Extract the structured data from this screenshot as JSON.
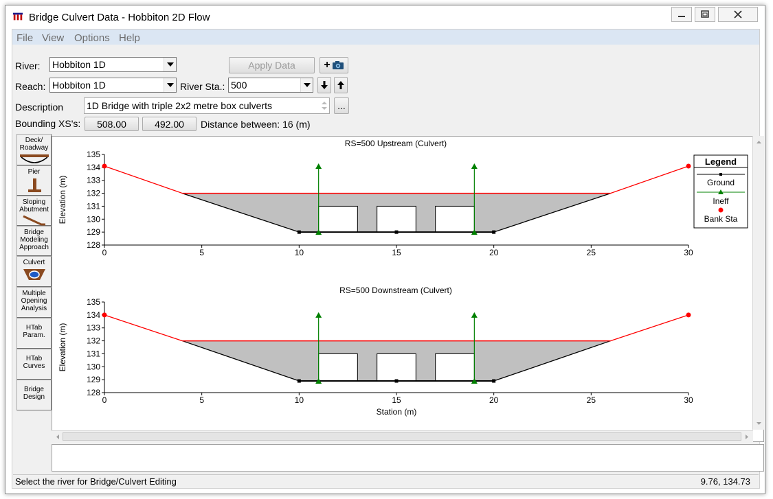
{
  "window": {
    "title": "Bridge Culvert Data - Hobbiton 2D Flow"
  },
  "menu": [
    "File",
    "View",
    "Options",
    "Help"
  ],
  "form": {
    "river_label": "River:",
    "river_value": "Hobbiton 1D",
    "reach_label": "Reach:",
    "reach_value": "Hobbiton 1D",
    "river_sta_label": "River Sta.:",
    "river_sta_value": "500",
    "apply_label": "Apply Data",
    "plus_label": "+",
    "description_label": "Description",
    "description_value": "1D Bridge with triple 2x2 metre box culverts",
    "ellipsis_label": "...",
    "bounding_label": "Bounding XS's:",
    "bounding_up": "508.00",
    "bounding_down": "492.00",
    "distance_text": "Distance between: 16 (m)"
  },
  "sidebar": [
    {
      "label": "Deck/ Roadway",
      "icon": "deck-roadway-icon"
    },
    {
      "label": "Pier",
      "icon": "pier-icon"
    },
    {
      "label": "Sloping Abutment",
      "icon": "sloping-abutment-icon"
    },
    {
      "label": "Bridge Modeling Approach",
      "icon": ""
    },
    {
      "label": "Culvert",
      "icon": "culvert-icon"
    },
    {
      "label": "Multiple Opening Analysis",
      "icon": ""
    },
    {
      "label": "HTab Param.",
      "icon": ""
    },
    {
      "label": "HTab Curves",
      "icon": ""
    },
    {
      "label": "Bridge Design",
      "icon": ""
    }
  ],
  "legend": {
    "title": "Legend",
    "items": [
      "Ground",
      "Ineff",
      "Bank Sta"
    ]
  },
  "colors": {
    "ground": "#000000",
    "ineff": "#008000",
    "bank": "#ff0000",
    "fill": "#c0c0c0",
    "deck": "#ff0000"
  },
  "chart_data": [
    {
      "type": "line",
      "title": "RS=500     Upstream  (Culvert)",
      "xlabel": "",
      "ylabel": "Elevation (m)",
      "xlim": [
        0,
        30
      ],
      "ylim": [
        128,
        135
      ],
      "xticks": [
        0,
        5,
        10,
        15,
        20,
        25,
        30
      ],
      "yticks": [
        128,
        129,
        130,
        131,
        132,
        133,
        134,
        135
      ],
      "ground": [
        [
          0,
          134.1
        ],
        [
          4,
          132
        ],
        [
          10,
          129
        ],
        [
          20,
          129
        ],
        [
          26,
          132
        ],
        [
          30,
          134.1
        ]
      ],
      "ground_markers": [
        [
          10,
          129
        ],
        [
          15,
          129
        ],
        [
          20,
          129
        ]
      ],
      "deck": [
        [
          4,
          132
        ],
        [
          26,
          132
        ]
      ],
      "ineff": [
        {
          "x": 11,
          "y0": 129,
          "y1": 134.1
        },
        {
          "x": 19,
          "y0": 129,
          "y1": 134.1
        }
      ],
      "bank": [
        [
          0,
          134.1
        ],
        [
          30,
          134.1
        ]
      ],
      "culverts": [
        [
          11,
          129,
          13,
          131
        ],
        [
          14,
          129,
          16,
          131
        ],
        [
          17,
          129,
          19,
          131
        ]
      ]
    },
    {
      "type": "line",
      "title": "RS=500     Downstream  (Culvert)",
      "xlabel": "Station (m)",
      "ylabel": "Elevation (m)",
      "xlim": [
        0,
        30
      ],
      "ylim": [
        128,
        135
      ],
      "xticks": [
        0,
        5,
        10,
        15,
        20,
        25,
        30
      ],
      "yticks": [
        128,
        129,
        130,
        131,
        132,
        133,
        134,
        135
      ],
      "ground": [
        [
          0,
          134
        ],
        [
          4,
          132
        ],
        [
          10,
          128.9
        ],
        [
          20,
          128.9
        ],
        [
          26,
          132
        ],
        [
          30,
          134
        ]
      ],
      "ground_markers": [
        [
          10,
          128.9
        ],
        [
          15,
          128.9
        ],
        [
          20,
          128.9
        ]
      ],
      "deck": [
        [
          4,
          132
        ],
        [
          26,
          132
        ]
      ],
      "ineff": [
        {
          "x": 11,
          "y0": 128.9,
          "y1": 134
        },
        {
          "x": 19,
          "y0": 128.9,
          "y1": 134
        }
      ],
      "bank": [
        [
          0,
          134
        ],
        [
          30,
          134
        ]
      ],
      "culverts": [
        [
          11,
          128.9,
          13,
          131
        ],
        [
          14,
          128.9,
          16,
          131
        ],
        [
          17,
          128.9,
          19,
          131
        ]
      ]
    }
  ],
  "status": {
    "message": "Select the river for Bridge/Culvert Editing",
    "coords": "9.76, 134.73"
  }
}
